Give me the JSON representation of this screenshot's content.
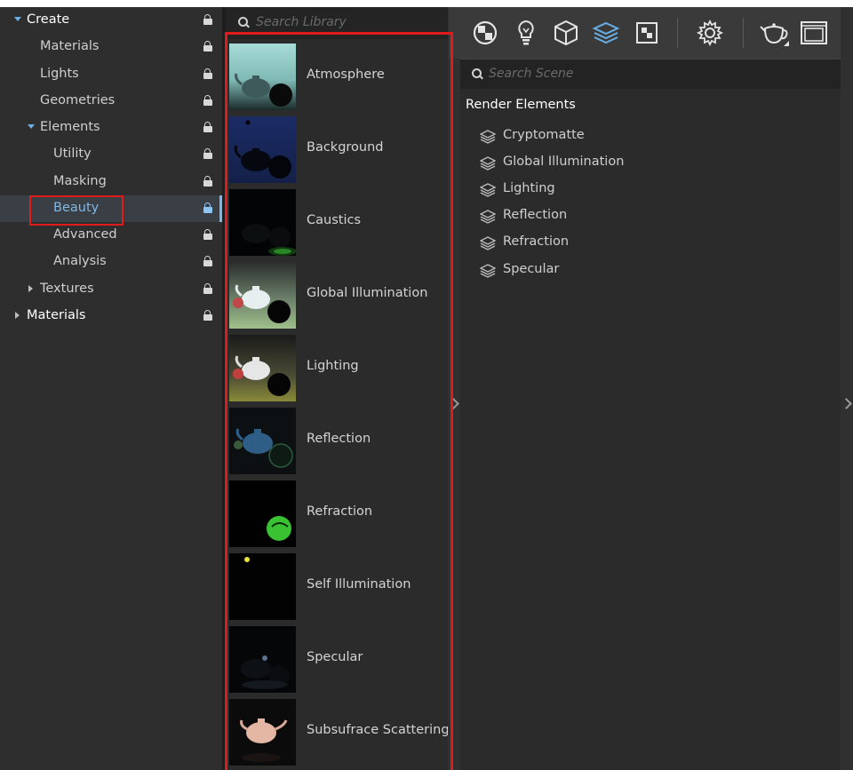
{
  "tree": {
    "items": [
      {
        "label": "Create",
        "top": true
      },
      {
        "label": "Materials"
      },
      {
        "label": "Lights"
      },
      {
        "label": "Geometries"
      },
      {
        "label": "Elements"
      },
      {
        "label": "Utility"
      },
      {
        "label": "Masking"
      },
      {
        "label": "Beauty",
        "selected": true
      },
      {
        "label": "Advanced"
      },
      {
        "label": "Analysis"
      },
      {
        "label": "Textures"
      },
      {
        "label": "Materials",
        "top": true
      }
    ]
  },
  "library": {
    "search_placeholder": "Search Library",
    "items": [
      {
        "label": "Atmosphere"
      },
      {
        "label": "Background"
      },
      {
        "label": "Caustics"
      },
      {
        "label": "Global Illumination"
      },
      {
        "label": "Lighting"
      },
      {
        "label": "Reflection"
      },
      {
        "label": "Refraction"
      },
      {
        "label": "Self Illumination"
      },
      {
        "label": "Specular"
      },
      {
        "label": "Subsufrace Scattering"
      }
    ]
  },
  "toolbar": {
    "icons": [
      "materials-icon",
      "lights-icon",
      "geometry-icon",
      "render-elements-icon",
      "textures-icon",
      "settings-icon",
      "teapot-render-icon",
      "frame-buffer-icon"
    ],
    "accent": "#6ab0e6"
  },
  "scene": {
    "search_placeholder": "Search Scene",
    "section_title": "Render Elements",
    "items": [
      "Cryptomatte",
      "Global Illumination",
      "Lighting",
      "Reflection",
      "Refraction",
      "Specular"
    ]
  },
  "colors": {
    "highlight_red": "#e11b1b",
    "selected_text": "#7fb8e8",
    "panel_bg": "#2b2b2b"
  }
}
